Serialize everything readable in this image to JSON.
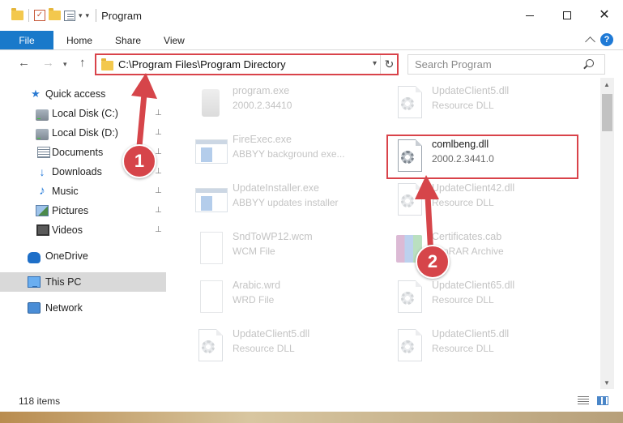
{
  "window": {
    "title": "Program",
    "minimize_glyph": "",
    "close_glyph": "✕"
  },
  "ribbon": {
    "tabs": [
      {
        "label": "File"
      },
      {
        "label": "Home"
      },
      {
        "label": "Share"
      },
      {
        "label": "View"
      }
    ],
    "help_glyph": "?"
  },
  "address": {
    "path": "C:\\Program Files\\Program Directory",
    "search_placeholder": "Search Program"
  },
  "sidebar": {
    "items": [
      {
        "label": "Quick access",
        "icon": "star-icon"
      },
      {
        "label": "Local Disk (C:)",
        "icon": "drive-icon",
        "pinned": true
      },
      {
        "label": "Local Disk (D:)",
        "icon": "drive-icon",
        "pinned": true
      },
      {
        "label": "Documents",
        "icon": "documents-icon",
        "pinned": true
      },
      {
        "label": "Downloads",
        "icon": "download-icon",
        "pinned": true
      },
      {
        "label": "Music",
        "icon": "music-icon",
        "pinned": true
      },
      {
        "label": "Pictures",
        "icon": "pictures-icon",
        "pinned": true
      },
      {
        "label": "Videos",
        "icon": "videos-icon",
        "pinned": true
      },
      {
        "label": "OneDrive",
        "icon": "cloud-icon"
      },
      {
        "label": "This PC",
        "icon": "computer-icon",
        "selected": true
      },
      {
        "label": "Network",
        "icon": "network-icon"
      }
    ]
  },
  "files": [
    {
      "name": "program.exe",
      "desc": "2000.2.34410",
      "icon": "program-icon"
    },
    {
      "name": "UpdateClient5.dll",
      "desc": "Resource DLL",
      "icon": "dll-icon"
    },
    {
      "name": "FireExec.exe",
      "desc": "ABBYY background exe...",
      "icon": "exe-icon"
    },
    {
      "name": "comlbeng.dll",
      "desc": "2000.2.3441.0",
      "icon": "dll-icon"
    },
    {
      "name": "UpdateInstaller.exe",
      "desc": "ABBYY updates installer",
      "icon": "exe-icon"
    },
    {
      "name": "UpdateClient42.dll",
      "desc": "Resource DLL",
      "icon": "dll-icon"
    },
    {
      "name": "SndToWP12.wcm",
      "desc": "WCM File",
      "icon": "file-icon"
    },
    {
      "name": "Certificates.cab",
      "desc": "WinRAR Archive",
      "icon": "archive-icon"
    },
    {
      "name": "Arabic.wrd",
      "desc": "WRD File",
      "icon": "file-icon"
    },
    {
      "name": "UpdateClient65.dll",
      "desc": "Resource DLL",
      "icon": "dll-icon"
    },
    {
      "name": "UpdateClient5.dll",
      "desc": "Resource DLL",
      "icon": "dll-icon"
    },
    {
      "name": "UpdateClient5.dll",
      "desc": "Resource DLL",
      "icon": "dll-icon"
    }
  ],
  "status": {
    "items_count": "118 items"
  },
  "annotations": {
    "step1": "1",
    "step2": "2",
    "color": "#d6454a"
  }
}
